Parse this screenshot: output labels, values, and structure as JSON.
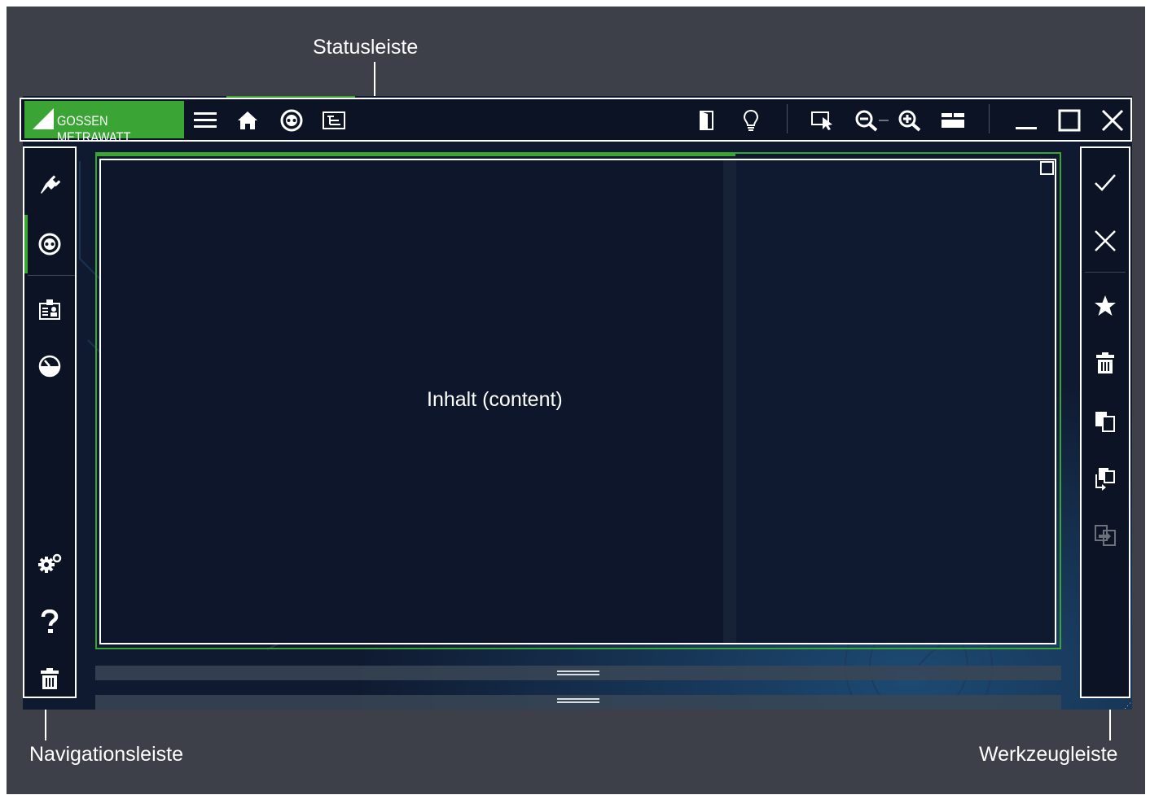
{
  "annotations": {
    "statusbar": "Statusleiste",
    "navbar": "Navigationsleiste",
    "toolbar": "Werkzeugleiste"
  },
  "statusbar": {
    "brand": "GOSSEN METRAWATT",
    "left_icons": [
      "menu-icon",
      "home-icon",
      "socket-icon",
      "tree-view-icon"
    ],
    "right_icons": [
      "door-icon",
      "lightbulb-icon",
      "select-cursor-icon",
      "zoom-out-icon",
      "zoom-in-icon",
      "panel-toggle-icon"
    ],
    "window_icons": [
      "minimize-icon",
      "maximize-icon",
      "close-icon"
    ]
  },
  "navbar": {
    "top_icons": [
      "plug-icon",
      "socket-icon"
    ],
    "middle_icons": [
      "customer-card-icon",
      "gauge-icon"
    ],
    "bottom_icons": [
      "settings-icon",
      "help-icon",
      "trash-icon"
    ]
  },
  "toolbar": {
    "icons": [
      "check-icon",
      "close-icon",
      "star-icon",
      "trash-icon",
      "copy-icon",
      "copy-to-icon",
      "move-icon"
    ]
  },
  "content": {
    "label": "Inhalt (content)"
  },
  "colors": {
    "accent": "#3aa535",
    "frame": "#3d3f49",
    "app_bg": "#0f1a30",
    "bar_bg": "#0b1324"
  }
}
